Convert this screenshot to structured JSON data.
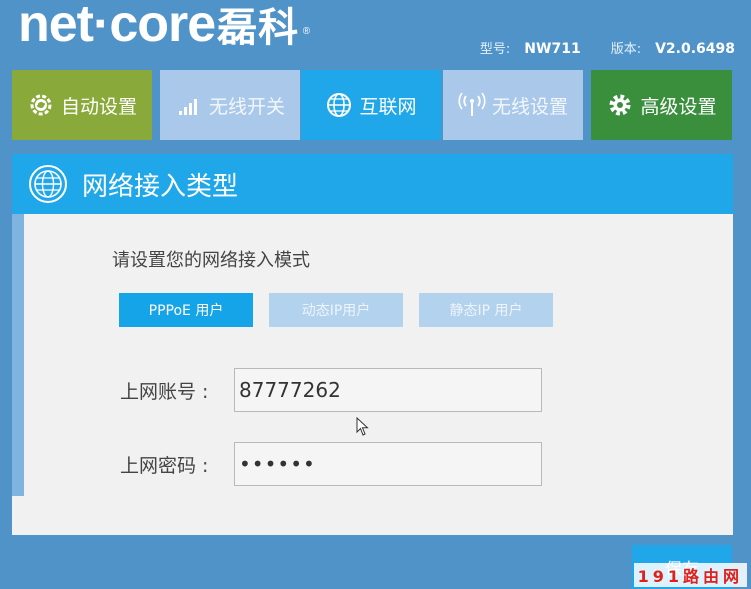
{
  "brand": {
    "logo_text": "net·core",
    "logo_cn": "磊科",
    "reg": "®"
  },
  "model_info": {
    "model_label": "型号:",
    "model_value": "NW711",
    "version_label": "版本:",
    "version_value": "V2.0.6498"
  },
  "tabs": [
    {
      "label": "自动设置",
      "icon": "gear-refresh-icon"
    },
    {
      "label": "无线开关",
      "icon": "signal-bars-icon"
    },
    {
      "label": "互联网",
      "icon": "globe-icon"
    },
    {
      "label": "无线设置",
      "icon": "antenna-icon"
    },
    {
      "label": "高级设置",
      "icon": "gear-icon"
    }
  ],
  "panel": {
    "title": "网络接入类型",
    "prompt": "请设置您的网络接入模式",
    "modes": [
      "PPPoE 用户",
      "动态IP用户",
      "静态IP 用户"
    ],
    "selected_mode": "PPPoE 用户",
    "account_label": "上网账号 :",
    "account_value": "87777262",
    "password_label": "上网密码 :",
    "password_value": "••••••",
    "save_label": "保存"
  },
  "watermark": "191路由网",
  "colors": {
    "background": "#4f93c9",
    "accent_blue": "#1fa7ea",
    "auto_tab": "#8aa93b",
    "advanced_tab": "#3a8f3d",
    "inactive_tab": "#aac9ea"
  }
}
